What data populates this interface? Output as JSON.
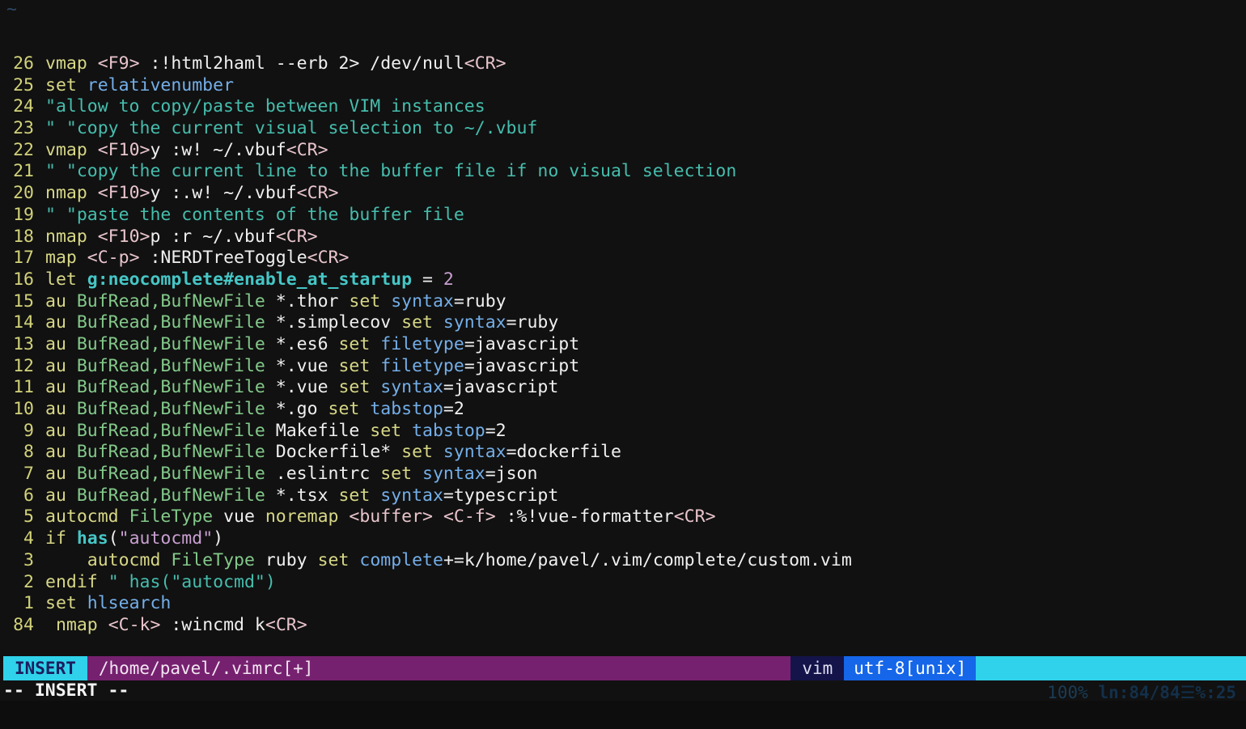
{
  "editor": {
    "name": "vim",
    "lines": [
      {
        "num": "26",
        "tokens": [
          {
            "t": "vmap",
            "c": "cmd"
          },
          {
            "t": " ",
            "c": "white"
          },
          {
            "t": "<F9>",
            "c": "special"
          },
          {
            "t": " :!html2haml --erb 2> /dev/null",
            "c": "white"
          },
          {
            "t": "<CR>",
            "c": "special"
          }
        ]
      },
      {
        "num": "25",
        "tokens": [
          {
            "t": "set",
            "c": "cmd"
          },
          {
            "t": " ",
            "c": "white"
          },
          {
            "t": "relativenumber",
            "c": "option"
          }
        ]
      },
      {
        "num": "24",
        "tokens": [
          {
            "t": "\"allow to copy/paste between VIM instances",
            "c": "comment"
          }
        ]
      },
      {
        "num": "23",
        "tokens": [
          {
            "t": "\" \"copy the current visual selection to ~/.vbuf",
            "c": "comment"
          }
        ]
      },
      {
        "num": "22",
        "tokens": [
          {
            "t": "vmap",
            "c": "cmd"
          },
          {
            "t": " ",
            "c": "white"
          },
          {
            "t": "<F10>",
            "c": "special"
          },
          {
            "t": "y :w! ~/.vbuf",
            "c": "white"
          },
          {
            "t": "<CR>",
            "c": "special"
          }
        ]
      },
      {
        "num": "21",
        "tokens": [
          {
            "t": "\" \"copy the current line to the buffer file if no visual selection",
            "c": "comment"
          }
        ]
      },
      {
        "num": "20",
        "tokens": [
          {
            "t": "nmap",
            "c": "cmd"
          },
          {
            "t": " ",
            "c": "white"
          },
          {
            "t": "<F10>",
            "c": "special"
          },
          {
            "t": "y :.w! ~/.vbuf",
            "c": "white"
          },
          {
            "t": "<CR>",
            "c": "special"
          }
        ]
      },
      {
        "num": "19",
        "tokens": [
          {
            "t": "\" \"paste the contents of the buffer file",
            "c": "comment"
          }
        ]
      },
      {
        "num": "18",
        "tokens": [
          {
            "t": "nmap",
            "c": "cmd"
          },
          {
            "t": " ",
            "c": "white"
          },
          {
            "t": "<F10>",
            "c": "special"
          },
          {
            "t": "p :r ~/.vbuf",
            "c": "white"
          },
          {
            "t": "<CR>",
            "c": "special"
          }
        ]
      },
      {
        "num": "17",
        "tokens": [
          {
            "t": "map",
            "c": "cmd"
          },
          {
            "t": " ",
            "c": "white"
          },
          {
            "t": "<C-p>",
            "c": "special"
          },
          {
            "t": " :NERDTreeToggle",
            "c": "white"
          },
          {
            "t": "<CR>",
            "c": "special"
          }
        ]
      },
      {
        "num": "16",
        "tokens": [
          {
            "t": "let",
            "c": "cmd"
          },
          {
            "t": " ",
            "c": "white"
          },
          {
            "t": "g:neocomplete#enable_at_startup",
            "c": "var"
          },
          {
            "t": " = ",
            "c": "white"
          },
          {
            "t": "2",
            "c": "number"
          }
        ]
      },
      {
        "num": "15",
        "tokens": [
          {
            "t": "au",
            "c": "cmd"
          },
          {
            "t": " ",
            "c": "white"
          },
          {
            "t": "BufRead,BufNewFile",
            "c": "group"
          },
          {
            "t": " *.thor ",
            "c": "white"
          },
          {
            "t": "set",
            "c": "cmd"
          },
          {
            "t": " ",
            "c": "white"
          },
          {
            "t": "syntax",
            "c": "option"
          },
          {
            "t": "=ruby",
            "c": "white"
          }
        ]
      },
      {
        "num": "14",
        "tokens": [
          {
            "t": "au",
            "c": "cmd"
          },
          {
            "t": " ",
            "c": "white"
          },
          {
            "t": "BufRead,BufNewFile",
            "c": "group"
          },
          {
            "t": " *.simplecov ",
            "c": "white"
          },
          {
            "t": "set",
            "c": "cmd"
          },
          {
            "t": " ",
            "c": "white"
          },
          {
            "t": "syntax",
            "c": "option"
          },
          {
            "t": "=ruby",
            "c": "white"
          }
        ]
      },
      {
        "num": "13",
        "tokens": [
          {
            "t": "au",
            "c": "cmd"
          },
          {
            "t": " ",
            "c": "white"
          },
          {
            "t": "BufRead,BufNewFile",
            "c": "group"
          },
          {
            "t": " *.es6 ",
            "c": "white"
          },
          {
            "t": "set",
            "c": "cmd"
          },
          {
            "t": " ",
            "c": "white"
          },
          {
            "t": "filetype",
            "c": "option"
          },
          {
            "t": "=javascript",
            "c": "white"
          }
        ]
      },
      {
        "num": "12",
        "tokens": [
          {
            "t": "au",
            "c": "cmd"
          },
          {
            "t": " ",
            "c": "white"
          },
          {
            "t": "BufRead,BufNewFile",
            "c": "group"
          },
          {
            "t": " *.vue ",
            "c": "white"
          },
          {
            "t": "set",
            "c": "cmd"
          },
          {
            "t": " ",
            "c": "white"
          },
          {
            "t": "filetype",
            "c": "option"
          },
          {
            "t": "=javascript",
            "c": "white"
          }
        ]
      },
      {
        "num": "11",
        "tokens": [
          {
            "t": "au",
            "c": "cmd"
          },
          {
            "t": " ",
            "c": "white"
          },
          {
            "t": "BufRead,BufNewFile",
            "c": "group"
          },
          {
            "t": " *.vue ",
            "c": "white"
          },
          {
            "t": "set",
            "c": "cmd"
          },
          {
            "t": " ",
            "c": "white"
          },
          {
            "t": "syntax",
            "c": "option"
          },
          {
            "t": "=javascript",
            "c": "white"
          }
        ]
      },
      {
        "num": "10",
        "tokens": [
          {
            "t": "au",
            "c": "cmd"
          },
          {
            "t": " ",
            "c": "white"
          },
          {
            "t": "BufRead,BufNewFile",
            "c": "group"
          },
          {
            "t": " *.go ",
            "c": "white"
          },
          {
            "t": "set",
            "c": "cmd"
          },
          {
            "t": " ",
            "c": "white"
          },
          {
            "t": "tabstop",
            "c": "option"
          },
          {
            "t": "=2",
            "c": "white"
          }
        ]
      },
      {
        "num": "9",
        "tokens": [
          {
            "t": "au",
            "c": "cmd"
          },
          {
            "t": " ",
            "c": "white"
          },
          {
            "t": "BufRead,BufNewFile",
            "c": "group"
          },
          {
            "t": " Makefile ",
            "c": "white"
          },
          {
            "t": "set",
            "c": "cmd"
          },
          {
            "t": " ",
            "c": "white"
          },
          {
            "t": "tabstop",
            "c": "option"
          },
          {
            "t": "=2",
            "c": "white"
          }
        ]
      },
      {
        "num": "8",
        "tokens": [
          {
            "t": "au",
            "c": "cmd"
          },
          {
            "t": " ",
            "c": "white"
          },
          {
            "t": "BufRead,BufNewFile",
            "c": "group"
          },
          {
            "t": " Dockerfile* ",
            "c": "white"
          },
          {
            "t": "set",
            "c": "cmd"
          },
          {
            "t": " ",
            "c": "white"
          },
          {
            "t": "syntax",
            "c": "option"
          },
          {
            "t": "=dockerfile",
            "c": "white"
          }
        ]
      },
      {
        "num": "7",
        "tokens": [
          {
            "t": "au",
            "c": "cmd"
          },
          {
            "t": " ",
            "c": "white"
          },
          {
            "t": "BufRead,BufNewFile",
            "c": "group"
          },
          {
            "t": " .eslintrc ",
            "c": "white"
          },
          {
            "t": "set",
            "c": "cmd"
          },
          {
            "t": " ",
            "c": "white"
          },
          {
            "t": "syntax",
            "c": "option"
          },
          {
            "t": "=json",
            "c": "white"
          }
        ]
      },
      {
        "num": "6",
        "tokens": [
          {
            "t": "au",
            "c": "cmd"
          },
          {
            "t": " ",
            "c": "white"
          },
          {
            "t": "BufRead,BufNewFile",
            "c": "group"
          },
          {
            "t": " *.tsx ",
            "c": "white"
          },
          {
            "t": "set",
            "c": "cmd"
          },
          {
            "t": " ",
            "c": "white"
          },
          {
            "t": "syntax",
            "c": "option"
          },
          {
            "t": "=typescript",
            "c": "white"
          }
        ]
      },
      {
        "num": "5",
        "tokens": [
          {
            "t": "autocmd",
            "c": "cmd"
          },
          {
            "t": " ",
            "c": "white"
          },
          {
            "t": "FileType",
            "c": "group"
          },
          {
            "t": " vue ",
            "c": "white"
          },
          {
            "t": "noremap",
            "c": "cmd"
          },
          {
            "t": " ",
            "c": "white"
          },
          {
            "t": "<buffer>",
            "c": "special"
          },
          {
            "t": " ",
            "c": "white"
          },
          {
            "t": "<C-f>",
            "c": "special"
          },
          {
            "t": " :%!vue-formatter",
            "c": "white"
          },
          {
            "t": "<CR>",
            "c": "special"
          }
        ]
      },
      {
        "num": "4",
        "tokens": [
          {
            "t": "if",
            "c": "cmd"
          },
          {
            "t": " ",
            "c": "white"
          },
          {
            "t": "has",
            "c": "func"
          },
          {
            "t": "(",
            "c": "white"
          },
          {
            "t": "\"autocmd\"",
            "c": "string"
          },
          {
            "t": ")",
            "c": "white"
          }
        ]
      },
      {
        "num": "3",
        "tokens": [
          {
            "t": "    ",
            "c": "white"
          },
          {
            "t": "autocmd",
            "c": "cmd"
          },
          {
            "t": " ",
            "c": "white"
          },
          {
            "t": "FileType",
            "c": "group"
          },
          {
            "t": " ruby ",
            "c": "white"
          },
          {
            "t": "set",
            "c": "cmd"
          },
          {
            "t": " ",
            "c": "white"
          },
          {
            "t": "complete",
            "c": "option"
          },
          {
            "t": "+=k/home/pavel/.vim/complete/custom.vim",
            "c": "white"
          }
        ]
      },
      {
        "num": "2",
        "tokens": [
          {
            "t": "endif",
            "c": "cmd"
          },
          {
            "t": " ",
            "c": "white"
          },
          {
            "t": "\" has(\"autocmd\")",
            "c": "comment"
          }
        ]
      },
      {
        "num": "1",
        "tokens": [
          {
            "t": "set",
            "c": "cmd"
          },
          {
            "t": " ",
            "c": "white"
          },
          {
            "t": "hlsearch",
            "c": "option"
          }
        ]
      },
      {
        "num": "84",
        "current": true,
        "tokens": [
          {
            "t": " ",
            "c": "white"
          },
          {
            "t": "nmap",
            "c": "cmd"
          },
          {
            "t": " ",
            "c": "white"
          },
          {
            "t": "<C-k>",
            "c": "special"
          },
          {
            "t": " :wincmd k",
            "c": "white"
          },
          {
            "t": "<CR>",
            "c": "special"
          }
        ]
      }
    ],
    "empty_marker": "~"
  },
  "statusline": {
    "mode": "INSERT",
    "file": "/home/pavel/.vimrc[+]",
    "app": "vim",
    "encoding": "utf-8[unix]",
    "percent": "100%",
    "line_label": "ln",
    "line_position": ":84/84",
    "column_glyph": "☰",
    "column": "%:25"
  },
  "cmdline": {
    "text": "-- INSERT --"
  },
  "colors": {
    "background": "#111111",
    "mode_bg": "#2fd2ea",
    "mode_fg": "#1c1c5e",
    "file_bg": "#76216f",
    "app_bg": "#14144a",
    "enc_bg": "#1566e8",
    "pos_bg": "#2fd2ea",
    "linenumber": "#d2d27a",
    "comment": "#46bdad",
    "keyword": "#d7d787",
    "option": "#74aee8",
    "group": "#83c98a",
    "special_key": "#e8c4cc",
    "string": "#c8a0d0"
  }
}
